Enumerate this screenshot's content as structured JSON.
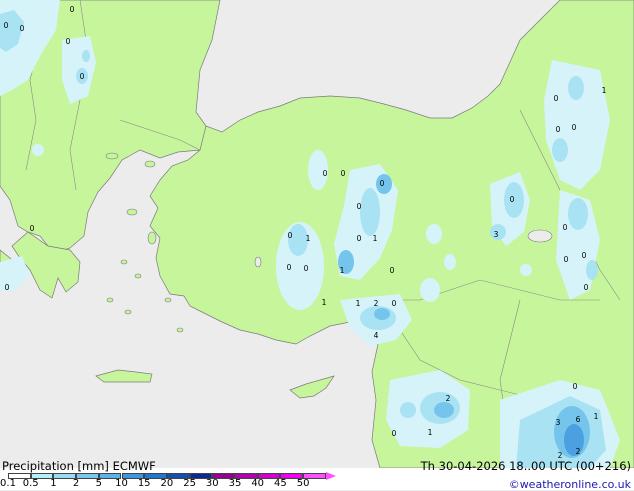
{
  "legend": {
    "title": "Precipitation [mm]  ECMWF",
    "datetime": "Th  30-04-2026  18..00 UTC (00+216)",
    "credit": "©weatheronline.co.uk",
    "ticks": [
      "0.1",
      "0.5",
      "1",
      "2",
      "5",
      "10",
      "15",
      "20",
      "25",
      "30",
      "35",
      "40",
      "45",
      "50"
    ],
    "colors": [
      "#ffffff",
      "#b4f0fa",
      "#96dcf5",
      "#78c8f0",
      "#5ab4eb",
      "#3c96e1",
      "#1e78d2",
      "#1450b4",
      "#0a2896",
      "#960096",
      "#b400b4",
      "#d200d2",
      "#f000f0",
      "#ff50ff"
    ]
  },
  "map": {
    "colors": {
      "sea": "#ececec",
      "land": "#c7f59b",
      "coast": "#7a7a7a",
      "precip_light": "#d7f3fa",
      "precip_mid": "#a8e2f3",
      "precip_heavy": "#74c4ec",
      "precip_core": "#4c9fe0"
    },
    "labels": [
      "0",
      "0",
      "0",
      "0",
      "0",
      "0",
      "0",
      "1",
      "0",
      "0",
      "0",
      "0",
      "0",
      "0",
      "0",
      "1",
      "0",
      "1",
      "0",
      "1",
      "3",
      "0",
      "0",
      "1",
      "2",
      "0",
      "4",
      "1",
      "0",
      "0",
      "0",
      "0",
      "0",
      "0",
      "2",
      "1",
      "0",
      "3",
      "6",
      "1",
      "2",
      "2"
    ]
  }
}
